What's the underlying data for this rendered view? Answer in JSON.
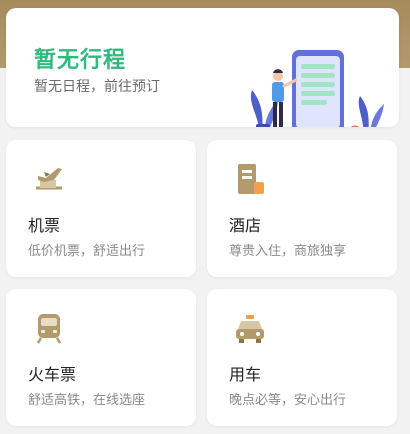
{
  "colors": {
    "accent_green": "#2fbb7d",
    "gold": "#b39a6d"
  },
  "hero": {
    "title": "暂无行程",
    "subtitle": "暂无日程，前往预订"
  },
  "services": [
    {
      "key": "flight",
      "title": "机票",
      "desc": "低价机票，舒适出行",
      "icon": "airplane-icon"
    },
    {
      "key": "hotel",
      "title": "酒店",
      "desc": "尊贵入住，商旅独享",
      "icon": "hotel-building-icon"
    },
    {
      "key": "train",
      "title": "火车票",
      "desc": "舒适高铁，在线选座",
      "icon": "train-icon"
    },
    {
      "key": "car",
      "title": "用车",
      "desc": "晚点必等，安心出行",
      "icon": "taxi-icon"
    }
  ]
}
